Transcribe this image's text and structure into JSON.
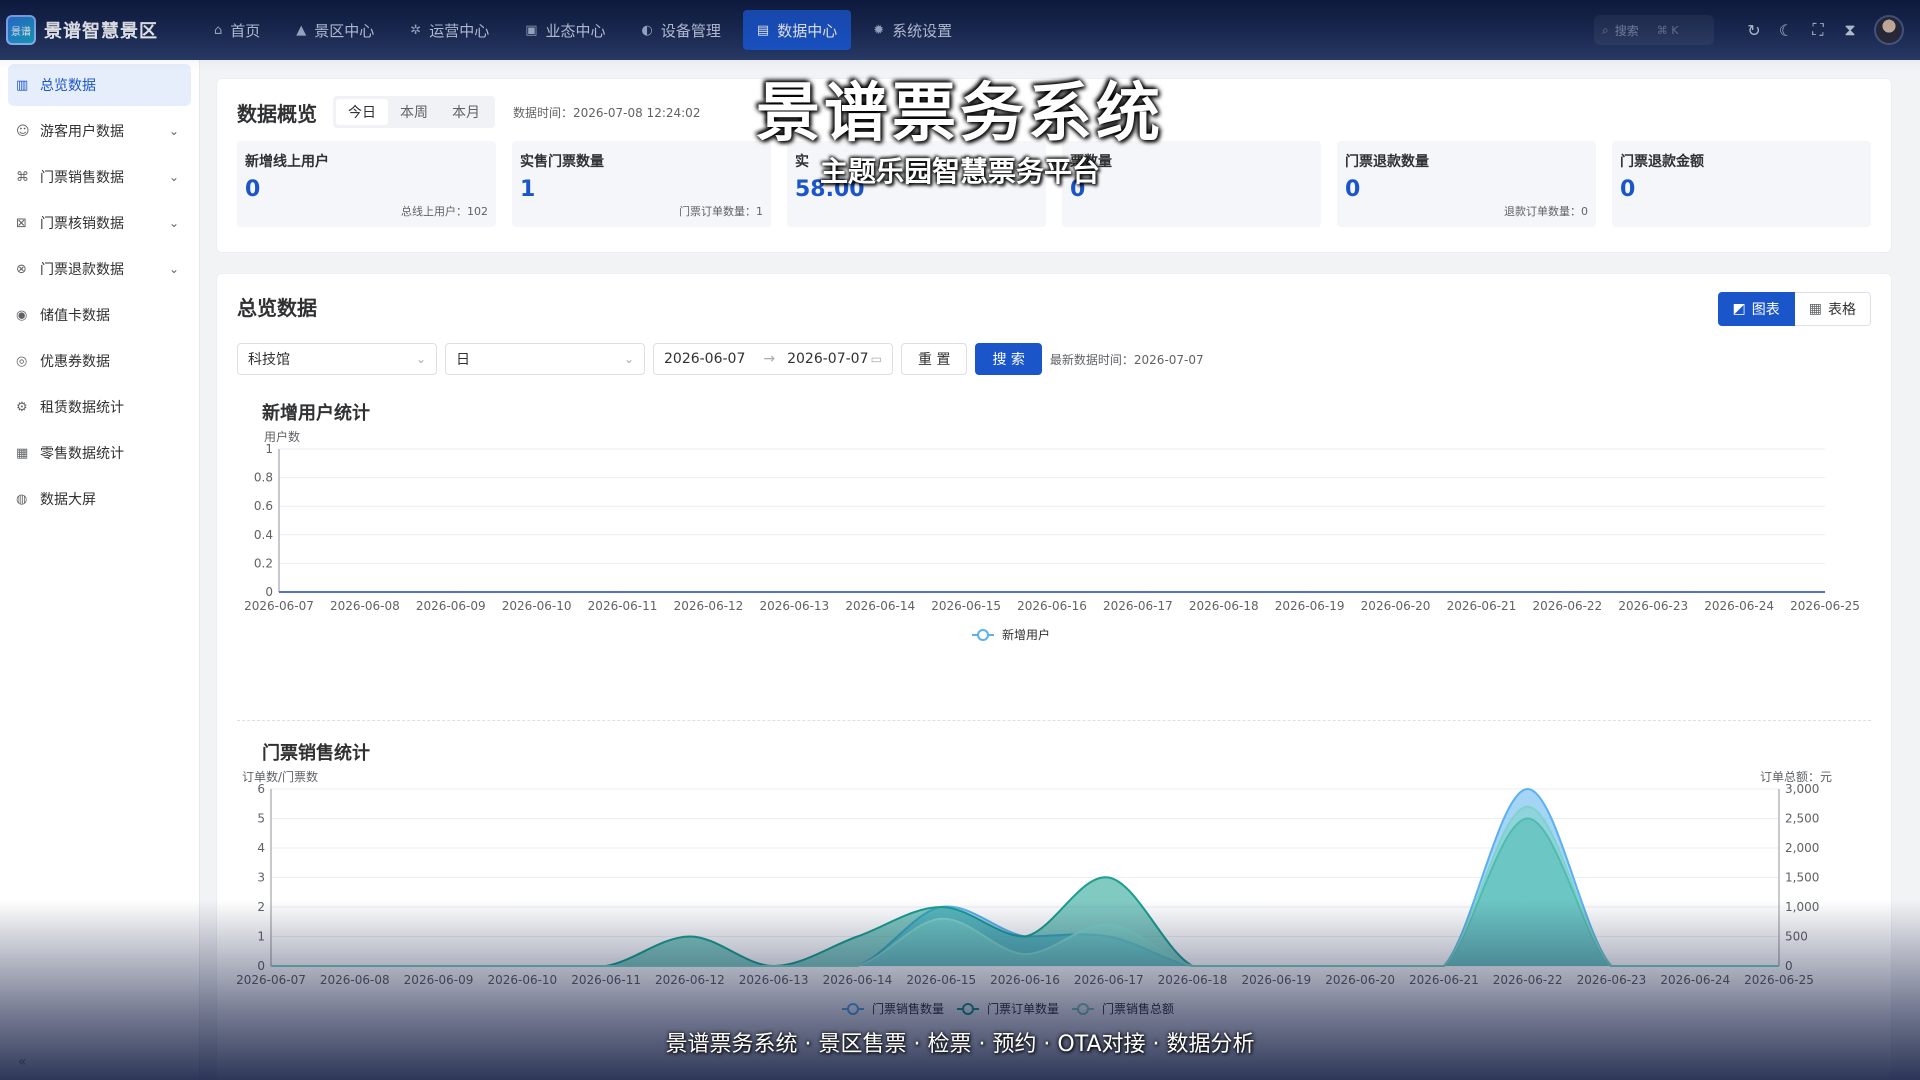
{
  "brand": {
    "name": "景谱智慧景区",
    "logo_text": "景谱"
  },
  "nav": [
    {
      "label": "首页",
      "icon": "home-icon",
      "glyph": "⌂"
    },
    {
      "label": "景区中心",
      "icon": "mountain-icon",
      "glyph": "▲"
    },
    {
      "label": "运营中心",
      "icon": "gear-cluster-icon",
      "glyph": "✲"
    },
    {
      "label": "业态中心",
      "icon": "store-icon",
      "glyph": "▣"
    },
    {
      "label": "设备管理",
      "icon": "device-icon",
      "glyph": "◐"
    },
    {
      "label": "数据中心",
      "icon": "chart-icon",
      "glyph": "▤",
      "active": true
    },
    {
      "label": "系统设置",
      "icon": "settings-icon",
      "glyph": "✹"
    }
  ],
  "top_right": {
    "search_placeholder": "搜索",
    "search_shortcut": "⌘ K"
  },
  "sidebar": [
    {
      "label": "总览数据",
      "icon": "bar-chart-icon",
      "glyph": "▥",
      "active": true
    },
    {
      "label": "游客用户数据",
      "icon": "users-icon",
      "glyph": "☺",
      "expandable": true
    },
    {
      "label": "门票销售数据",
      "icon": "ticket-icon",
      "glyph": "⌘",
      "expandable": true
    },
    {
      "label": "门票核销数据",
      "icon": "ticket-check-icon",
      "glyph": "⊠",
      "expandable": true
    },
    {
      "label": "门票退款数据",
      "icon": "refund-icon",
      "glyph": "⊗",
      "expandable": true
    },
    {
      "label": "储值卡数据",
      "icon": "card-icon",
      "glyph": "◉"
    },
    {
      "label": "优惠券数据",
      "icon": "coupon-icon",
      "glyph": "◎"
    },
    {
      "label": "租赁数据统计",
      "icon": "rental-icon",
      "glyph": "⚙"
    },
    {
      "label": "零售数据统计",
      "icon": "retail-icon",
      "glyph": "▦"
    },
    {
      "label": "数据大屏",
      "icon": "screen-icon",
      "glyph": "◍"
    }
  ],
  "overview": {
    "title": "数据概览",
    "periods": [
      "今日",
      "本周",
      "本月"
    ],
    "active_period": "今日",
    "data_time": "数据时间：2026-07-08 12:24:02",
    "stats": [
      {
        "label": "新增线上用户",
        "value": "0",
        "sub": "总线上用户：102"
      },
      {
        "label": "实售门票数量",
        "value": "1",
        "sub": "门票订单数量：1"
      },
      {
        "label": "实",
        "value": "58.00",
        "sub": ""
      },
      {
        "label": "票数量",
        "value": "0",
        "sub": ""
      },
      {
        "label": "门票退款数量",
        "value": "0",
        "sub": "退款订单数量：0"
      },
      {
        "label": "门票退款金额",
        "value": "0",
        "sub": ""
      }
    ]
  },
  "overall": {
    "title": "总览数据",
    "view_chart": "图表",
    "view_table": "表格",
    "venue": "科技馆",
    "granularity": "日",
    "date_start": "2026-06-07",
    "date_end": "2026-07-07",
    "reset_label": "重 置",
    "search_label": "搜 索",
    "latest": "最新数据时间：2026-07-07"
  },
  "chart_data": [
    {
      "type": "line",
      "title": "新增用户统计",
      "ylabel": "用户数",
      "ylim": [
        0,
        1
      ],
      "yticks": [
        "0",
        "0.2",
        "0.4",
        "0.6",
        "0.8",
        "1"
      ],
      "x": [
        "2026-06-07",
        "2026-06-08",
        "2026-06-09",
        "2026-06-10",
        "2026-06-11",
        "2026-06-12",
        "2026-06-13",
        "2026-06-14",
        "2026-06-15",
        "2026-06-16",
        "2026-06-17",
        "2026-06-18",
        "2026-06-19",
        "2026-06-20",
        "2026-06-21",
        "2026-06-22",
        "2026-06-23",
        "2026-06-24",
        "2026-06-25"
      ],
      "series": [
        {
          "name": "新增用户",
          "values": [
            0,
            0,
            0,
            0,
            0,
            0,
            0,
            0,
            0,
            0,
            0,
            0,
            0,
            0,
            0,
            0,
            0,
            0,
            0
          ],
          "color": "#5470c6"
        }
      ],
      "legend": "bottom-center"
    },
    {
      "type": "area",
      "title": "门票销售统计",
      "ylabel": "订单数/门票数",
      "y2label": "订单总额：元",
      "ylim": [
        0,
        6
      ],
      "y2lim": [
        0,
        3000
      ],
      "yticks": [
        "0",
        "1",
        "2",
        "3",
        "4",
        "5",
        "6"
      ],
      "y2ticks": [
        "0",
        "500",
        "1,000",
        "1,500",
        "2,000",
        "2,500",
        "3,000"
      ],
      "x": [
        "2026-06-07",
        "2026-06-08",
        "2026-06-09",
        "2026-06-10",
        "2026-06-11",
        "2026-06-12",
        "2026-06-13",
        "2026-06-14",
        "2026-06-15",
        "2026-06-16",
        "2026-06-17",
        "2026-06-18",
        "2026-06-19",
        "2026-06-20",
        "2026-06-21",
        "2026-06-22",
        "2026-06-23",
        "2026-06-24",
        "2026-06-25"
      ],
      "series": [
        {
          "name": "门票销售数量",
          "axis": "left",
          "values": [
            0,
            0,
            0,
            0,
            0,
            0,
            0,
            0,
            2,
            1,
            1,
            0,
            0,
            0,
            0,
            6,
            0,
            0,
            0
          ],
          "color": "#5ab1ef"
        },
        {
          "name": "门票订单数量",
          "axis": "left",
          "values": [
            0,
            0,
            0,
            0,
            0,
            1,
            0,
            1,
            2,
            1,
            3,
            0,
            0,
            0,
            0,
            5,
            0,
            0,
            0
          ],
          "color": "#1a9e8f"
        },
        {
          "name": "门票销售总额",
          "axis": "right",
          "values": [
            0,
            0,
            0,
            0,
            0,
            0,
            0,
            0,
            800,
            200,
            700,
            0,
            0,
            0,
            0,
            2700,
            0,
            0,
            0
          ],
          "color": "#7ed3c8"
        }
      ],
      "legend": "bottom-center"
    }
  ],
  "overlay": {
    "title": "景谱票务系统",
    "subtitle": "主题乐园智慧票务平台",
    "footer": "景谱票务系统 · 景区售票 · 检票 · 预约 · OTA对接 · 数据分析"
  }
}
